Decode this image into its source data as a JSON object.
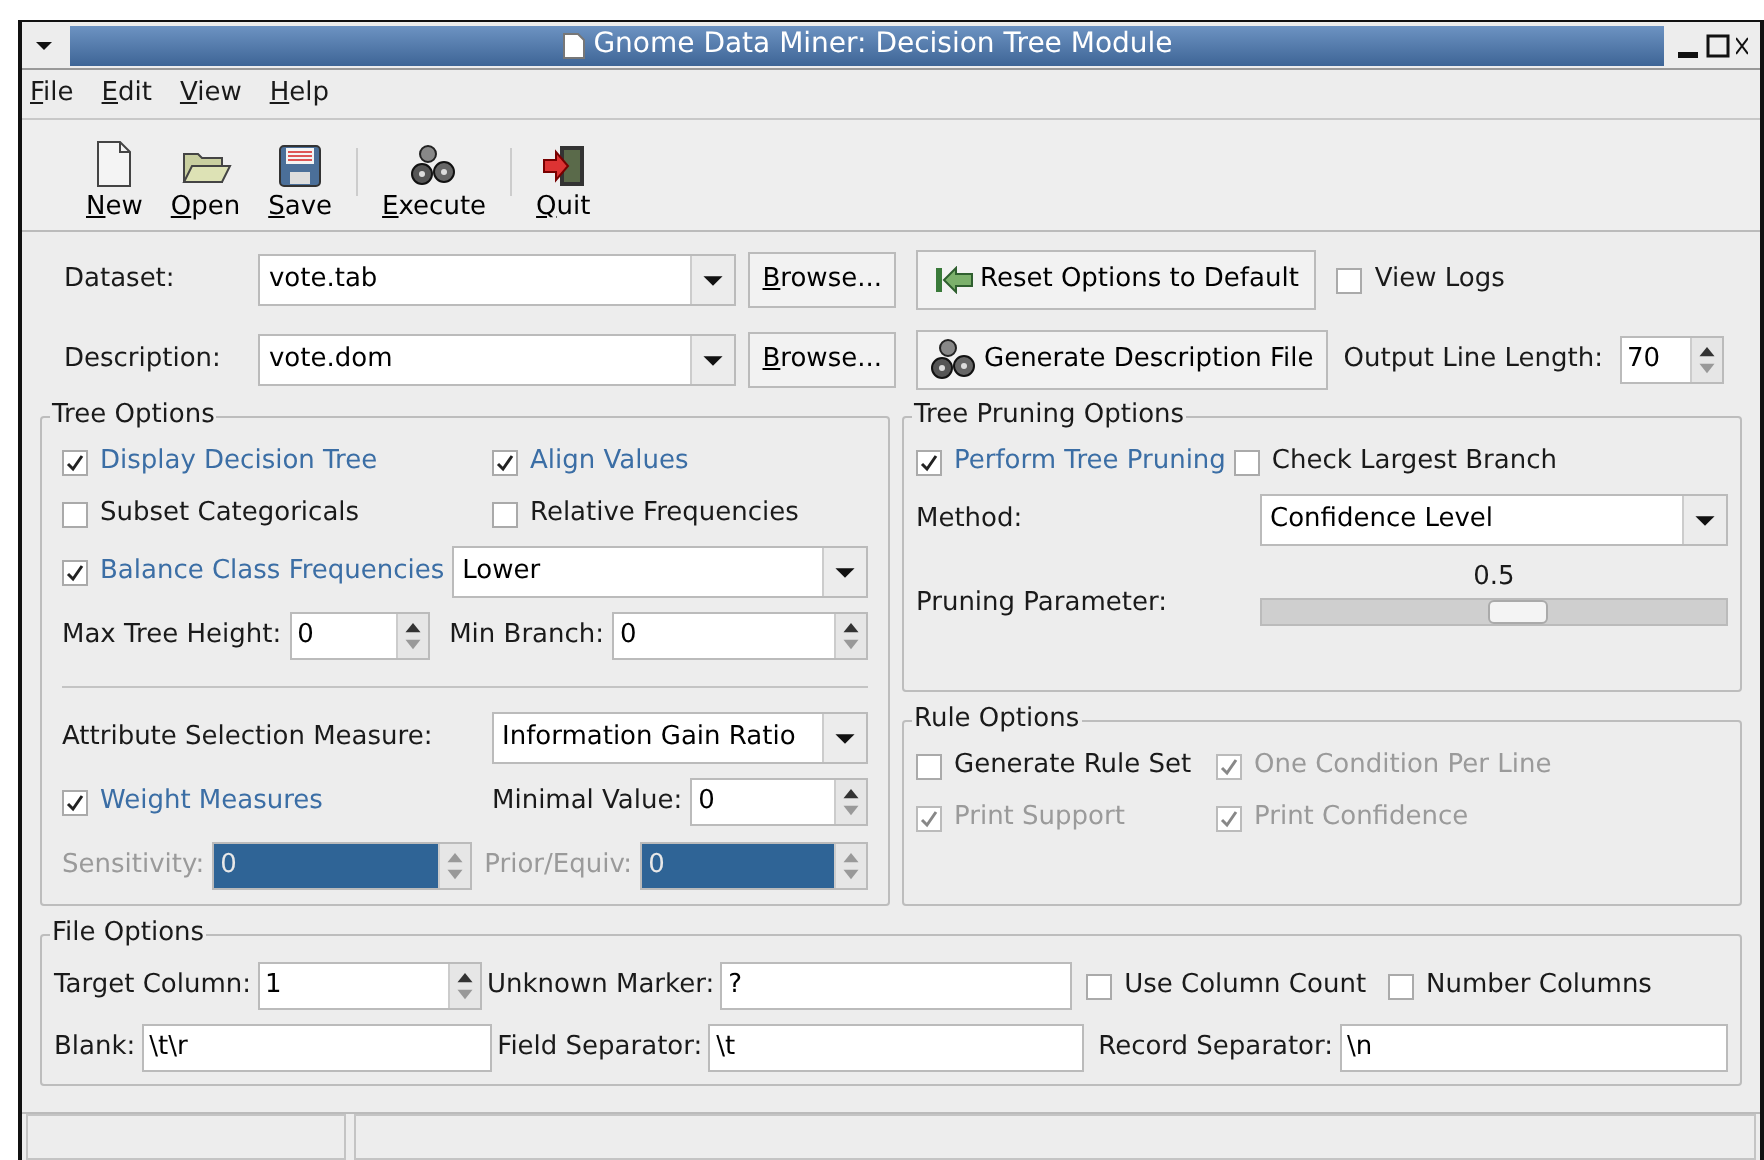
{
  "window": {
    "title": "Gnome Data Miner: Decision Tree Module"
  },
  "menu": [
    "File",
    "Edit",
    "View",
    "Help"
  ],
  "toolbar": [
    {
      "label": "New",
      "kind": "new"
    },
    {
      "label": "Open",
      "kind": "open"
    },
    {
      "label": "Save",
      "kind": "save"
    },
    {
      "label": "Execute",
      "kind": "execute"
    },
    {
      "label": "Quit",
      "kind": "quit"
    }
  ],
  "dataset": {
    "label": "Dataset:",
    "value": "vote.tab",
    "button": "Browse..."
  },
  "description": {
    "label": "Description:",
    "value": "vote.dom",
    "button": "Browse..."
  },
  "reset_button": "Reset Options to Default",
  "view_logs": {
    "label": "View Logs",
    "checked": false,
    "disabled": false
  },
  "generate_button": "Generate Description File",
  "output_line_length": {
    "label": "Output Line Length:",
    "value": "70"
  },
  "tree_options": {
    "title": "Tree Options",
    "display_decision_tree": {
      "label": "Display Decision Tree",
      "checked": true,
      "disabled": false
    },
    "align_values": {
      "label": "Align Values",
      "checked": true,
      "disabled": false
    },
    "subset_categoricals": {
      "label": "Subset Categoricals",
      "checked": false,
      "disabled": false
    },
    "relative_frequencies": {
      "label": "Relative Frequencies",
      "checked": false,
      "disabled": false
    },
    "balance_class_frequencies": {
      "label": "Balance Class Frequencies",
      "checked": true,
      "disabled": false
    },
    "balance_value": "Lower",
    "max_tree_height": {
      "label": "Max Tree Height:",
      "value": "0",
      "disabled": false
    },
    "min_branch": {
      "label": "Min Branch:",
      "value": "0",
      "disabled": false
    },
    "attribute_selection_measure": {
      "label": "Attribute Selection Measure:",
      "value": "Information Gain Ratio"
    },
    "weight_measures": {
      "label": "Weight Measures",
      "checked": true,
      "disabled": false
    },
    "minimal_value": {
      "label": "Minimal Value:",
      "value": "0",
      "disabled": false
    },
    "sensitivity": {
      "label": "Sensitivity:",
      "value": "0",
      "disabled": true
    },
    "prior_equiv": {
      "label": "Prior/Equiv:",
      "value": "0",
      "disabled": true
    }
  },
  "tree_pruning_options": {
    "title": "Tree Pruning Options",
    "perform_tree_pruning": {
      "label": "Perform Tree Pruning",
      "checked": true,
      "disabled": false
    },
    "check_largest_branch": {
      "label": "Check Largest Branch",
      "checked": false,
      "disabled": false
    },
    "method": {
      "label": "Method:",
      "value": "Confidence Level"
    },
    "pruning_parameter": {
      "label": "Pruning Parameter:",
      "reading": "0.5",
      "level": 0.55
    }
  },
  "rule_options": {
    "title": "Rule Options",
    "checkboxes": [
      {
        "label": "Generate Rule Set",
        "checked": false,
        "disabled": false
      },
      {
        "label": "One Condition Per Line",
        "checked": true,
        "disabled": true
      },
      {
        "label": "Print Support",
        "checked": true,
        "disabled": true
      },
      {
        "label": "Print Confidence",
        "checked": true,
        "disabled": true
      }
    ]
  },
  "file_options": {
    "title": "File Options",
    "target_column": {
      "label": "Target Column:",
      "value": "1",
      "disabled": false
    },
    "unknown_marker": {
      "label": "Unknown Marker:",
      "value": "?"
    },
    "use_column_count": {
      "label": "Use Column Count",
      "checked": false,
      "disabled": false
    },
    "number_columns": {
      "label": "Number Columns",
      "checked": false,
      "disabled": false
    },
    "blank": {
      "label": "Blank:",
      "value": "\\t\\r"
    },
    "field_separator": {
      "label": "Field Separator:",
      "value": "\\t"
    },
    "record_separator": {
      "label": "Record Separator:",
      "value": "\\n"
    }
  }
}
